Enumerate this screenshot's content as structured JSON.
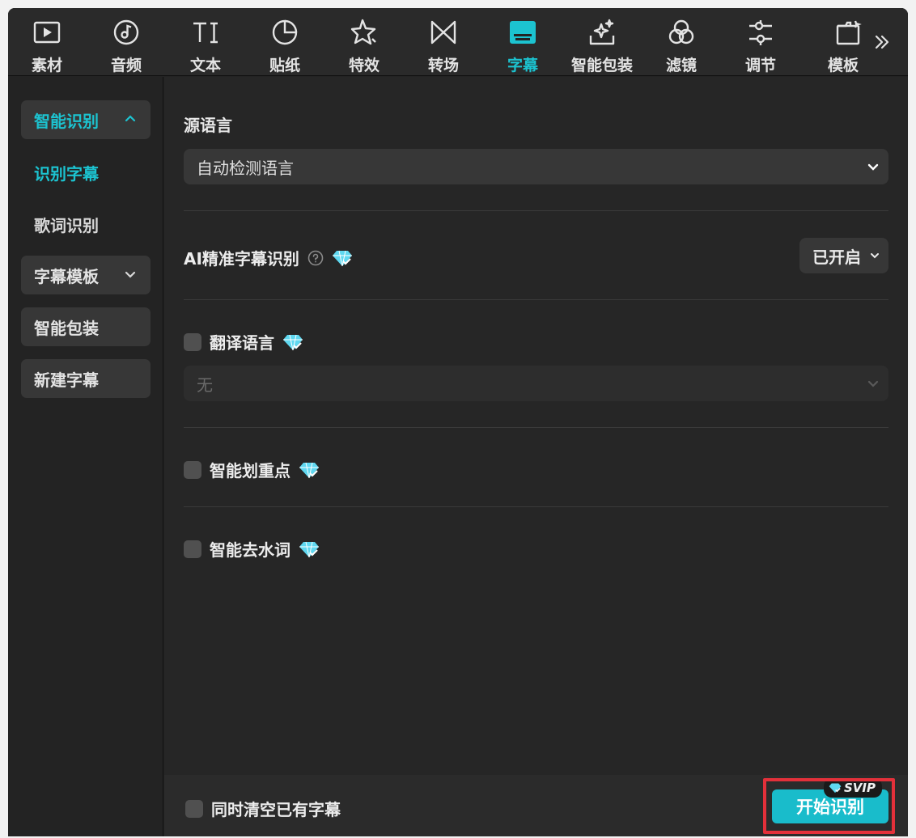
{
  "toolbar": {
    "items": [
      {
        "label": "素材",
        "icon": "media-play-icon"
      },
      {
        "label": "音频",
        "icon": "music-note-icon"
      },
      {
        "label": "文本",
        "icon": "text-ti-icon"
      },
      {
        "label": "贴纸",
        "icon": "sticker-icon"
      },
      {
        "label": "特效",
        "icon": "effects-star-icon"
      },
      {
        "label": "转场",
        "icon": "transition-bowtie-icon"
      },
      {
        "label": "字幕",
        "icon": "subtitle-icon",
        "active": true
      },
      {
        "label": "智能包装",
        "icon": "smart-package-sparkle-icon"
      },
      {
        "label": "滤镜",
        "icon": "filter-circles-icon"
      },
      {
        "label": "调节",
        "icon": "adjust-sliders-icon"
      },
      {
        "label": "模板",
        "icon": "template-icon"
      }
    ],
    "more_icon": "double-chevron-right-icon"
  },
  "sidebar": {
    "smart_recognition": "智能识别",
    "recognize_subtitles": "识别字幕",
    "lyrics_recognition": "歌词识别",
    "subtitle_templates": "字幕模板",
    "smart_package": "智能包装",
    "new_subtitle": "新建字幕"
  },
  "main": {
    "source_language_title": "源语言",
    "source_language_value": "自动检测语言",
    "ai_precise_label": "AI精准字幕识别",
    "ai_precise_state": "已开启",
    "translate_label": "翻译语言",
    "translate_value": "无",
    "highlight_label": "智能划重点",
    "filler_label": "智能去水词"
  },
  "footer": {
    "clear_existing_label": "同时清空已有字幕",
    "start_button": "开始识别",
    "svip_badge": "SVIP"
  },
  "colors": {
    "accent": "#1cc3d0",
    "highlight_box": "#e3303a",
    "gem": "#5fd8f0"
  }
}
